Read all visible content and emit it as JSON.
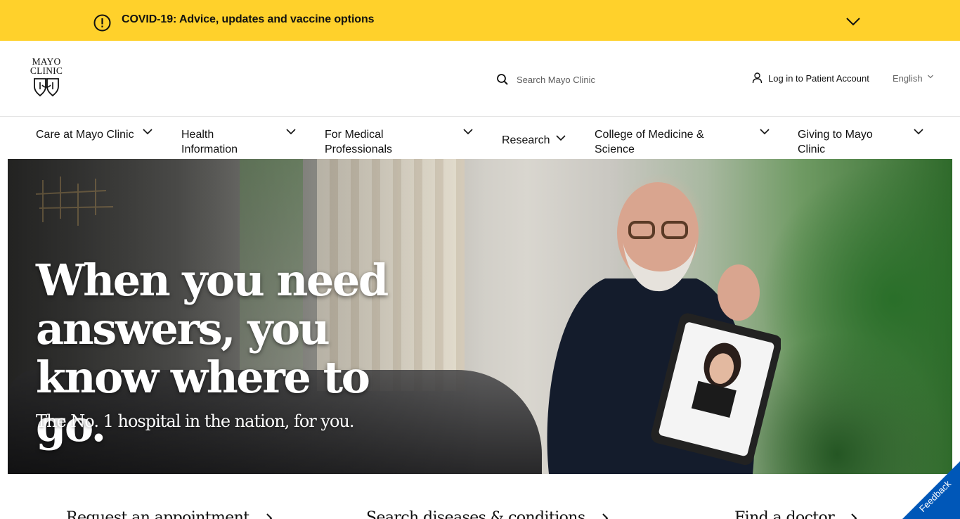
{
  "covid_banner": {
    "text": "COVID-19: Advice, updates and vaccine options",
    "icon": "alert-circle-icon",
    "background": "#ffd12b"
  },
  "header": {
    "logo": {
      "line1": "MAYO",
      "line2": "CLINIC"
    },
    "search": {
      "placeholder": "Search Mayo Clinic",
      "value": ""
    },
    "login_label": "Log in to Patient Account",
    "language": "English"
  },
  "nav": {
    "items": [
      {
        "label": "Care at Mayo Clinic"
      },
      {
        "label": "Health Information"
      },
      {
        "label": "For Medical Professionals"
      },
      {
        "label": "Research"
      },
      {
        "label": "College of Medicine & Science"
      },
      {
        "label": "Giving to Mayo Clinic"
      }
    ]
  },
  "hero": {
    "headline": "When you need answers, you know where to go.",
    "subheadline": "The No. 1 hospital in the nation, for you."
  },
  "quick_links": [
    {
      "label": "Request an appointment"
    },
    {
      "label": "Search diseases & conditions"
    },
    {
      "label": "Find a doctor"
    }
  ],
  "feedback": {
    "label": "Feedback",
    "color": "#0057b8"
  }
}
